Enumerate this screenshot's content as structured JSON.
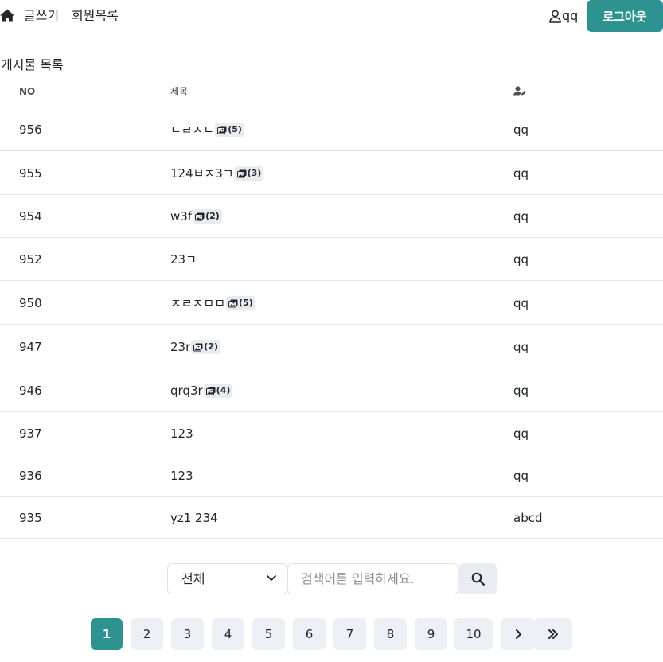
{
  "nav": {
    "write_label": "글쓰기",
    "members_label": "회원목록",
    "username": "qq",
    "logout_label": "로그아웃"
  },
  "board": {
    "title": "게시물 목록",
    "headers": {
      "no": "NO",
      "title": "제목",
      "author_icon": "user-pen-icon"
    },
    "rows": [
      {
        "no": "956",
        "title": "ㄷㄹㅈㄷ",
        "badge": "(5)",
        "author": "qq"
      },
      {
        "no": "955",
        "title": "124ㅂㅈ3ㄱ",
        "badge": "(3)",
        "author": "qq"
      },
      {
        "no": "954",
        "title": "w3f",
        "badge": "(2)",
        "author": "qq"
      },
      {
        "no": "952",
        "title": "23ㄱ",
        "badge": "",
        "author": "qq"
      },
      {
        "no": "950",
        "title": "ㅈㄹㅈㅁㅁ",
        "badge": "(5)",
        "author": "qq"
      },
      {
        "no": "947",
        "title": "23r",
        "badge": "(2)",
        "author": "qq"
      },
      {
        "no": "946",
        "title": "qrq3r",
        "badge": "(4)",
        "author": "qq"
      },
      {
        "no": "937",
        "title": "123",
        "badge": "",
        "author": "qq"
      },
      {
        "no": "936",
        "title": "123",
        "badge": "",
        "author": "qq"
      },
      {
        "no": "935",
        "title": "yz1 234",
        "badge": "",
        "author": "abcd"
      }
    ]
  },
  "search": {
    "scope_selected": "전체",
    "placeholder": "검색어를 입력하세요.",
    "button_icon": "search-icon"
  },
  "pagination": {
    "pages": [
      "1",
      "2",
      "3",
      "4",
      "5",
      "6",
      "7",
      "8",
      "9",
      "10"
    ],
    "current": "1",
    "next_icon": "chevron-right-icon",
    "last_icon": "double-chevron-right-icon"
  },
  "colors": {
    "accent": "#2e9390",
    "button_bg": "#eceff3",
    "border": "#e3e6ea"
  }
}
